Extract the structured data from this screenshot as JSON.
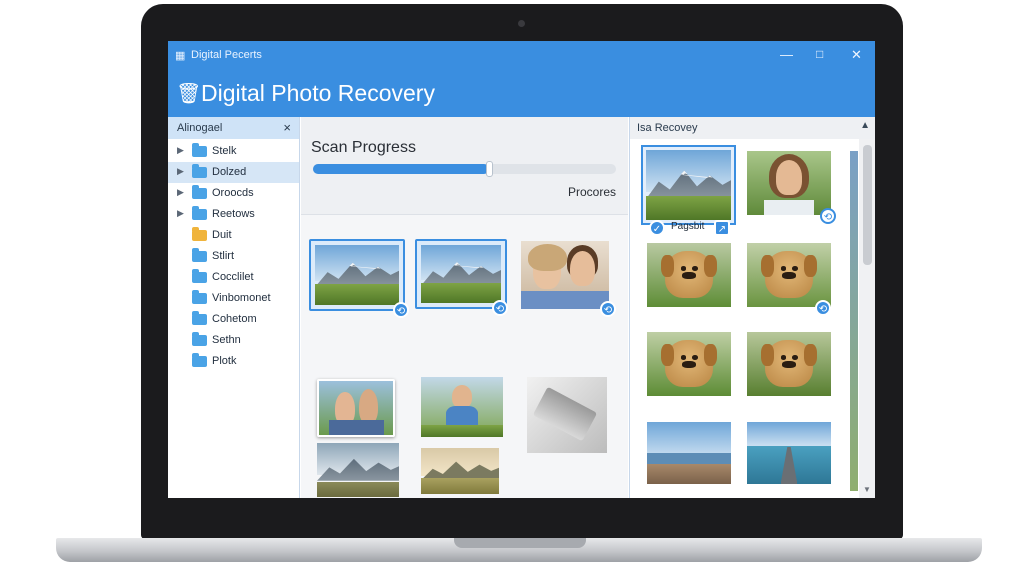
{
  "window": {
    "title": "Digital Pecerts",
    "controls": {
      "minimize": "—",
      "maximize": "□",
      "close": "✕"
    }
  },
  "header": {
    "title": "Digital Photo Recovery",
    "icon": "trash-restore-icon"
  },
  "sidebar": {
    "title": "Alinogael",
    "close": "×",
    "items": [
      {
        "label": "Stelk",
        "expandable": true,
        "color": "#4aa3e6"
      },
      {
        "label": "Dolzed",
        "expandable": true,
        "color": "#4aa3e6",
        "selected": true
      },
      {
        "label": "Oroocds",
        "expandable": true,
        "color": "#4aa3e6"
      },
      {
        "label": "Reetows",
        "expandable": true,
        "color": "#4aa3e6"
      },
      {
        "label": "Duit",
        "expandable": false,
        "color": "#f0b43c"
      },
      {
        "label": "Stlirt",
        "expandable": false,
        "color": "#4aa3e6"
      },
      {
        "label": "Cocclilet",
        "expandable": false,
        "color": "#4aa3e6"
      },
      {
        "label": "Vinbomonet",
        "expandable": false,
        "color": "#4aa3e6"
      },
      {
        "label": "Cohetom",
        "expandable": false,
        "color": "#4aa3e6"
      },
      {
        "label": "Sethn",
        "expandable": false,
        "color": "#4aa3e6"
      },
      {
        "label": "Plotk",
        "expandable": false,
        "color": "#4aa3e6"
      }
    ]
  },
  "scan": {
    "title": "Scan Progress",
    "progress": 0.58,
    "status": "Procores"
  },
  "recovery": {
    "title": "Isa Recovey",
    "selected_label": "Pagsbit",
    "scroll_up": "▲",
    "scroll_down": "▼"
  },
  "colors": {
    "accent": "#3a8ee0",
    "titlebar": "#3a8ee0",
    "sidebar_header": "#cfe3f7"
  }
}
